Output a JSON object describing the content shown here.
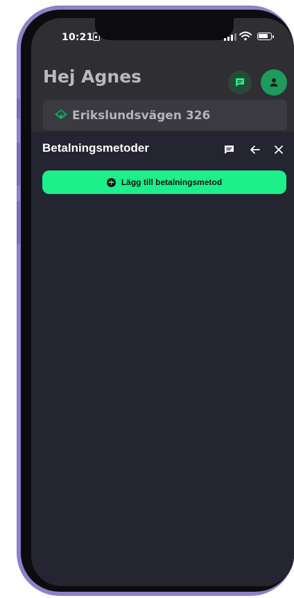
{
  "status_bar": {
    "time": "10:21"
  },
  "header": {
    "greeting": "Hej Agnes",
    "address": "Erikslundsvägen 326"
  },
  "sheet": {
    "title": "Betalningsmetoder",
    "add_button_label": "Lägg till betalningsmetod"
  },
  "colors": {
    "accent": "#1cf08a",
    "background": "#242530",
    "frame": "#8f80c9"
  },
  "icons": [
    "chat-icon",
    "user-icon",
    "address-diamond-icon",
    "back-arrow-icon",
    "close-icon",
    "plus-circle-icon",
    "signal-icon",
    "wifi-icon",
    "battery-icon",
    "lock-icon"
  ]
}
